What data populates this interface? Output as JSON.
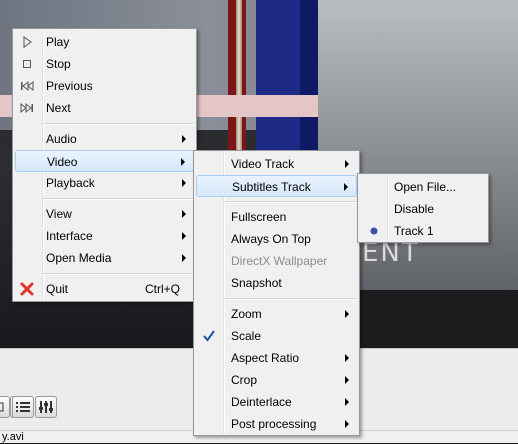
{
  "main_menu": {
    "play": "Play",
    "stop": "Stop",
    "previous": "Previous",
    "next": "Next",
    "audio": "Audio",
    "video": "Video",
    "playback": "Playback",
    "view": "View",
    "interface": "Interface",
    "open_media": "Open Media",
    "quit": "Quit",
    "quit_shortcut": "Ctrl+Q"
  },
  "video_menu": {
    "video_track": "Video Track",
    "subtitles_track": "Subtitles Track",
    "fullscreen": "Fullscreen",
    "always_on_top": "Always On Top",
    "directx_wallpaper": "DirectX Wallpaper",
    "snapshot": "Snapshot",
    "zoom": "Zoom",
    "scale": "Scale",
    "aspect_ratio": "Aspect Ratio",
    "crop": "Crop",
    "deinterlace": "Deinterlace",
    "post_processing": "Post processing"
  },
  "subtitles_menu": {
    "open_file": "Open File...",
    "disable": "Disable",
    "track1": "Track 1"
  },
  "video_frame": {
    "overlay_text": "ENT"
  },
  "status": {
    "filename": "y.avi"
  },
  "colors": {
    "menu_bg": "#f0f0f0",
    "highlight": "#d6e8fb",
    "quit_icon": "#e8322c",
    "check": "#1d4fa3"
  }
}
